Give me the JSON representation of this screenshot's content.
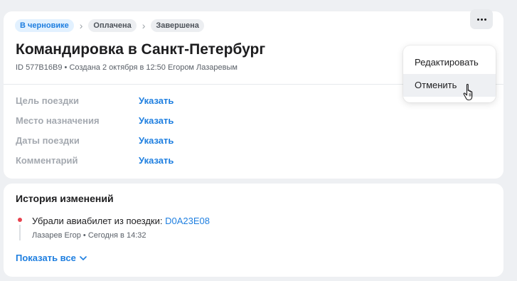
{
  "trip": {
    "statuses": [
      "В черновике",
      "Оплачена",
      "Завершена"
    ],
    "title": "Командировка в Санкт-Петербург",
    "id_prefix": "ID",
    "id": "577B16B9",
    "created": "Создана 2 октября в 12:50 Егором Лазаревым",
    "fields": [
      {
        "label": "Цель поездки",
        "action": "Указать"
      },
      {
        "label": "Место назначения",
        "action": "Указать"
      },
      {
        "label": "Даты поездки",
        "action": "Указать"
      },
      {
        "label": "Комментарий",
        "action": "Указать"
      }
    ]
  },
  "menu": {
    "items": [
      "Редактировать",
      "Отменить"
    ],
    "hovered_index": 1
  },
  "history": {
    "title": "История изменений",
    "entry": {
      "text": "Убрали авиабилет из поездки:",
      "link": "D0A23E08",
      "author": "Лазарев Егор",
      "time": "Сегодня в 14:32"
    },
    "show_all": "Показать все"
  },
  "colors": {
    "accent": "#1f7fe0",
    "active_status_bg": "#e2f1ff",
    "timeline_dot": "#e8424e"
  },
  "icons": {
    "more": "more-horizontal-icon",
    "step_separator": "chevron-right-icon",
    "show_all": "chevron-down-icon",
    "cursor": "hand-pointer-icon"
  }
}
